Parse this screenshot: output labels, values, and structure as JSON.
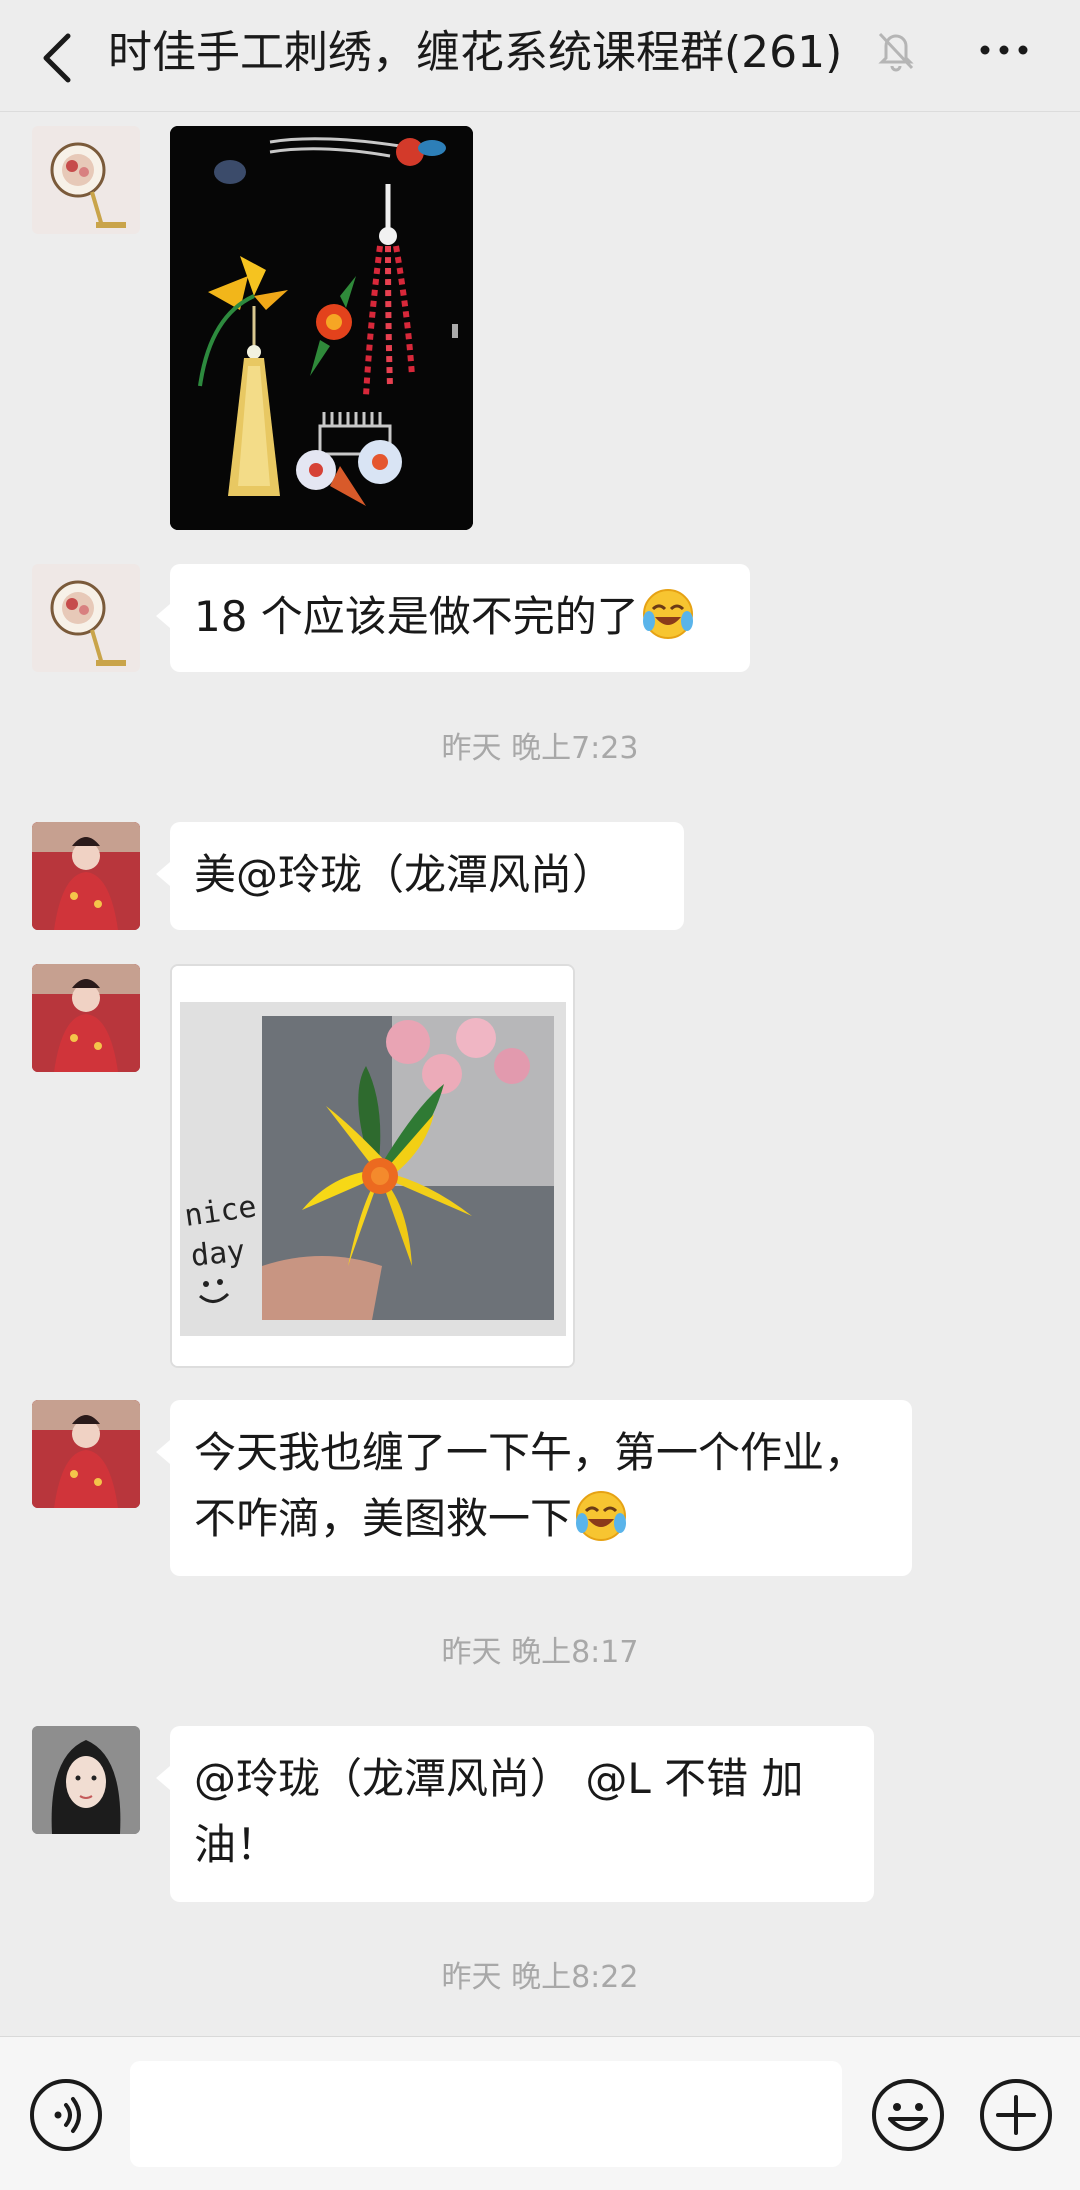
{
  "header": {
    "title": "时佳手工刺绣，缠花系统课程群(261)"
  },
  "messages": [
    {
      "type": "image",
      "sender": "fan-avatar",
      "image": "hairpin-collection-photo"
    },
    {
      "type": "text",
      "sender": "fan-avatar",
      "text": "18 个应该是做不完的了",
      "emoji": "laughing-crying-emoji"
    },
    {
      "type": "time",
      "text": "昨天 晚上7:23"
    },
    {
      "type": "text",
      "sender": "red-dress-avatar",
      "text": "美@玲珑（龙潭风尚）"
    },
    {
      "type": "image",
      "sender": "red-dress-avatar",
      "image": "yellow-flower-photo",
      "overlay_text": [
        "nice",
        "day"
      ]
    },
    {
      "type": "text",
      "sender": "red-dress-avatar",
      "lines": [
        "今天我也缠了一下午，第一个作业，",
        "不咋滴，美图救一下"
      ],
      "emoji": "laughing-crying-emoji"
    },
    {
      "type": "time",
      "text": "昨天 晚上8:17"
    },
    {
      "type": "text",
      "sender": "girl-avatar",
      "lines": [
        "@玲珑（龙潭风尚） @L  不错 加",
        "油！"
      ]
    },
    {
      "type": "time",
      "text": "昨天 晚上8:22"
    }
  ],
  "icons": {
    "back": "chevron-left-icon",
    "mute": "bell-off-icon",
    "more": "more-dots-icon",
    "voice": "voice-icon",
    "emoji": "smiley-icon",
    "plus": "plus-icon"
  },
  "colors": {
    "background": "#ededed",
    "bubble": "#ffffff",
    "timestamp": "#a8a8a8"
  }
}
